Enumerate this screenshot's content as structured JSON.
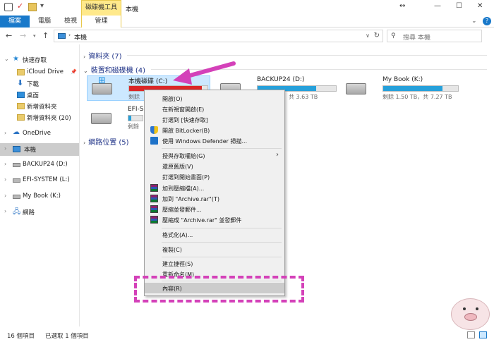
{
  "titlebar": {
    "tool_tab": "磁碟機工具",
    "title": "本機",
    "quick_access": [
      "checkbox-icon",
      "properties-icon",
      "new-folder-icon",
      "customize-dropdown-icon"
    ]
  },
  "ribbon": {
    "tabs": [
      {
        "label": "檔案",
        "active": true
      },
      {
        "label": "電腦"
      },
      {
        "label": "檢視"
      },
      {
        "label": "管理"
      }
    ]
  },
  "address": {
    "path": "本機",
    "search_placeholder": "搜尋 本機"
  },
  "navpane": {
    "items": [
      {
        "label": "快速存取",
        "icon": "star-icon"
      },
      {
        "label": "iCloud Drive",
        "icon": "folder-icon",
        "pinned": true
      },
      {
        "label": "下載",
        "icon": "download-icon"
      },
      {
        "label": "桌面",
        "icon": "desktop-icon"
      },
      {
        "label": "新增資料夾",
        "icon": "folder-icon"
      },
      {
        "label": "新增資料夾 (20)",
        "icon": "folder-icon"
      },
      {
        "label": "OneDrive",
        "icon": "cloud-icon"
      },
      {
        "label": "本機",
        "icon": "computer-icon",
        "selected": true
      },
      {
        "label": "BACKUP24 (D:)",
        "icon": "drive-icon"
      },
      {
        "label": "EFI-SYSTEM (L:)",
        "icon": "drive-icon"
      },
      {
        "label": "My Book (K:)",
        "icon": "drive-icon"
      },
      {
        "label": "網路",
        "icon": "network-icon"
      }
    ]
  },
  "content": {
    "groups": {
      "folders": "資料夾 (7)",
      "devices": "裝置和磁碟機 (4)",
      "network": "網路位置 (5)"
    },
    "drives": [
      {
        "name": "本機磁碟 (C:)",
        "free_text": "剩餘",
        "used_fraction": 0.93,
        "bar_color": "#da2626"
      },
      {
        "name": "BACKUP24 (D:)",
        "free_text": "，共 3.63 TB",
        "used_fraction": 0.75,
        "bar_color": "#26a0da"
      },
      {
        "name": "My Book (K:)",
        "free_text": "剩餘 1.50 TB，共 7.27 TB",
        "used_fraction": 0.79,
        "bar_color": "#26a0da"
      },
      {
        "name": "EFI-S",
        "free_text": "剩餘",
        "used_fraction": 0.2,
        "bar_color": "#26a0da"
      }
    ]
  },
  "context_menu": {
    "items": [
      {
        "label": "開啟(O)"
      },
      {
        "label": "在新視窗開啟(E)"
      },
      {
        "label": "釘選到 [快速存取]"
      },
      {
        "label": "開啟 BitLocker(B)",
        "icon": "bitlocker-shield-icon"
      },
      {
        "label": "使用 Windows Defender 掃描...",
        "icon": "windows-defender-icon"
      },
      {
        "label": "授與存取權給(G)",
        "submenu": true
      },
      {
        "label": "還原舊版(V)"
      },
      {
        "label": "釘選到開始畫面(P)"
      },
      {
        "label": "加到壓縮檔(A)...",
        "icon": "winrar-icon"
      },
      {
        "label": "加到 \"Archive.rar\"(T)",
        "icon": "winrar-icon"
      },
      {
        "label": "壓縮並發郵件...",
        "icon": "winrar-icon"
      },
      {
        "label": "壓縮成 \"Archive.rar\" 並發郵件",
        "icon": "winrar-icon"
      },
      {
        "label": "格式化(A)..."
      },
      {
        "label": "複製(C)"
      },
      {
        "label": "建立捷徑(S)"
      },
      {
        "label": "重新命名(M)"
      },
      {
        "label": "內容(R)",
        "highlighted": true
      }
    ]
  },
  "statusbar": {
    "count": "16 個項目",
    "selected": "已選取 1 個項目"
  },
  "colors": {
    "accent": "#1979ca",
    "annotation": "#d441b9",
    "tool_tab": "#ffe98b"
  }
}
